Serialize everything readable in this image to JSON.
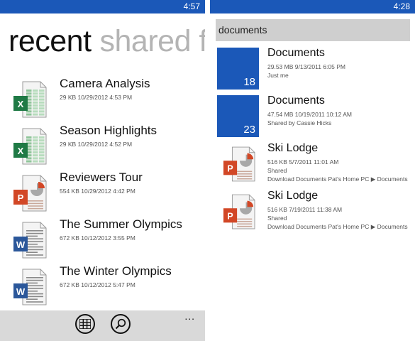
{
  "left": {
    "status": {
      "time": "4:57"
    },
    "pivot": {
      "active": "recent",
      "inactive": "shared f"
    },
    "files": [
      {
        "type": "excel",
        "name": "Camera Analysis",
        "size": "29 KB",
        "date": "10/29/2012 4:53 PM"
      },
      {
        "type": "excel",
        "name": "Season Highlights",
        "size": "29 KB",
        "date": "10/29/2012 4:52 PM"
      },
      {
        "type": "powerpoint",
        "name": "Reviewers Tour",
        "size": "554 KB",
        "date": "10/29/2012 4:42 PM"
      },
      {
        "type": "word",
        "name": "The Summer Olympics",
        "size": "672 KB",
        "date": "10/12/2012 3:55 PM"
      },
      {
        "type": "word",
        "name": "The Winter Olympics",
        "size": "672 KB",
        "date": "10/12/2012 5:47 PM"
      }
    ],
    "appbar": {
      "buttons": [
        "list-icon",
        "search-icon"
      ],
      "more": "..."
    }
  },
  "right": {
    "status": {
      "time": "4:28"
    },
    "search": {
      "value": "documents"
    },
    "results": [
      {
        "kind": "folder",
        "count": "18",
        "name": "Documents",
        "size": "29.53 MB",
        "date": "9/13/2011 6:05 PM",
        "line2": "Just me",
        "line3": ""
      },
      {
        "kind": "folder",
        "count": "23",
        "name": "Documents",
        "size": "47.54 MB",
        "date": "10/19/2011 10:12 AM",
        "line2": "Shared by Cassie Hicks",
        "line3": ""
      },
      {
        "kind": "powerpoint",
        "count": "",
        "name": "Ski Lodge",
        "size": "516 KB",
        "date": "5/7/2011 11:01 AM",
        "line2": "Shared",
        "line3": "Download Documents Pat's Home PC ▶ Documents"
      },
      {
        "kind": "powerpoint",
        "count": "",
        "name": "Ski Lodge",
        "size": "516 KB",
        "date": "7/19/2011 11:38 AM",
        "line2": "Shared",
        "line3": "Download Documents Pat's Home PC ▶ Documents"
      }
    ]
  },
  "colors": {
    "accent": "#1b58b8",
    "excel": "#1f7a45",
    "powerpoint": "#d24726",
    "word": "#2b579a",
    "appbar": "#d9d9d9"
  }
}
